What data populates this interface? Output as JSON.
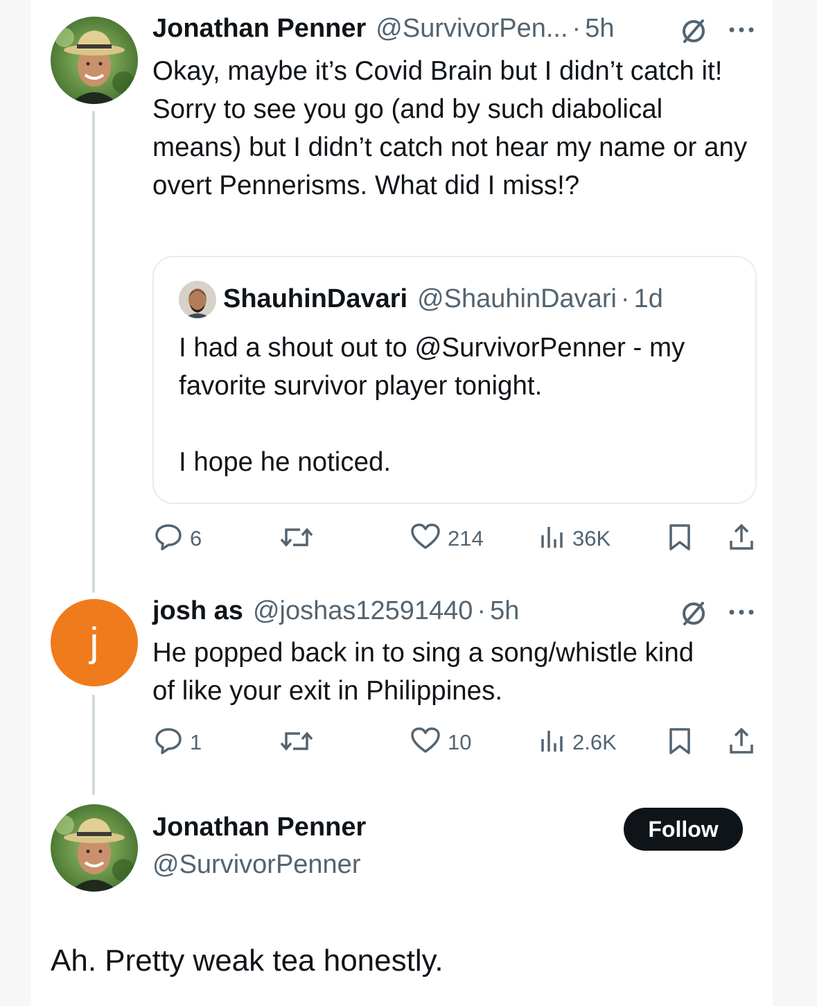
{
  "tweet1": {
    "author_name": "Jonathan Penner",
    "author_handle": "@SurvivorPen...",
    "separator": "·",
    "time": "5h",
    "text": "Okay, maybe it’s Covid Brain but I didn’t catch it! Sorry to see you go (and by such diabolical means) but I didn’t catch not hear my name or any overt Pennerisms. What did I miss!?",
    "quote": {
      "author_name": "ShauhinDavari",
      "author_handle": "@ShauhinDavari",
      "separator": "·",
      "time": "1d",
      "text_line1": "I had a shout out to @SurvivorPenner - my favorite survivor player tonight.",
      "text_line2": "I hope he noticed."
    },
    "stats": {
      "replies": "6",
      "likes": "214",
      "views": "36K"
    }
  },
  "tweet2": {
    "avatar_letter": "j",
    "avatar_color": "#f07b1c",
    "author_name": "josh as",
    "author_handle": "@joshas12591440",
    "separator": "·",
    "time": "5h",
    "text": "He popped back in to sing a song/whistle kind of like your exit in Philippines.",
    "stats": {
      "replies": "1",
      "likes": "10",
      "views": "2.6K"
    }
  },
  "main_tweet": {
    "author_name": "Jonathan Penner",
    "author_handle": "@SurvivorPenner",
    "follow_label": "Follow",
    "text": "Ah. Pretty weak tea honestly."
  },
  "colors": {
    "text": "#0f1419",
    "secondary": "#536471",
    "thread_line": "#cfd9de",
    "follow_bg": "#0f1419"
  },
  "icons": [
    "grok-slash-icon",
    "more-icon",
    "reply-icon",
    "retweet-icon",
    "like-icon",
    "views-icon",
    "bookmark-icon",
    "share-icon"
  ]
}
